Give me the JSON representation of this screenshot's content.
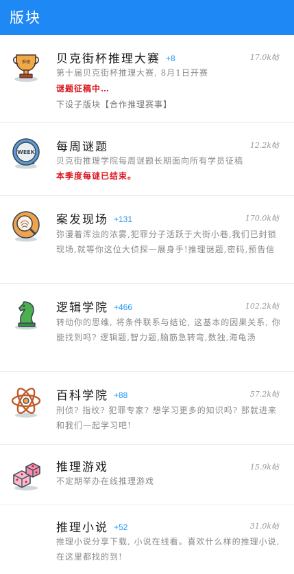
{
  "header": {
    "title": "版块"
  },
  "boards": [
    {
      "icon": "trophy-icon",
      "name": "贝克街杯推理大赛",
      "plus": "+8",
      "posts": "17.0k帖",
      "desc": "第十届贝克街杯推理大赛, 8月1日开赛",
      "note": "谜题征稿中…",
      "sub": "下设子版块【合作推理赛事】"
    },
    {
      "icon": "week-clock-icon",
      "name": "每周谜题",
      "plus": "",
      "posts": "12.2k帖",
      "desc": "贝克街推理学院每周谜题长期面向所有学员征稿",
      "note": "本季度每谜已结束。",
      "sub": ""
    },
    {
      "icon": "magnifier-fingerprint-icon",
      "name": "案发现场",
      "plus": "+131",
      "posts": "170.0k帖",
      "desc": "弥漫着浑浊的浓雾,犯罪分子活跃于大街小巷,我们已封锁现场,就等你这位大侦探一展身手!推理谜题,密码,预告信",
      "note": "",
      "sub": ""
    },
    {
      "icon": "chess-knight-icon",
      "name": "逻辑学院",
      "plus": "+466",
      "posts": "102.2k帖",
      "desc": "转动你的思维, 将条件联系与结论, 这基本的因果关系, 你能找到吗? 逻辑题,智力题,脑筋急转弯,数独,海龟汤",
      "note": "",
      "sub": ""
    },
    {
      "icon": "atom-icon",
      "name": "百科学院",
      "plus": "+88",
      "posts": "57.2k帖",
      "desc": "刑侦? 指纹? 犯罪专家? 想学习更多的知识吗? 那就进来和我们一起学习吧!",
      "note": "",
      "sub": ""
    },
    {
      "icon": "dice-icon",
      "name": "推理游戏",
      "plus": "",
      "posts": "15.9k帖",
      "desc": "不定期举办在线推理游戏",
      "note": "",
      "sub": ""
    },
    {
      "icon": "",
      "name": "推理小说",
      "plus": "+52",
      "posts": "31.0k帖",
      "desc": "推理小说分享下载, 小说在线看。喜欢什么样的推理小说, 在这里都找的到!",
      "note": "",
      "sub": ""
    }
  ],
  "colors": {
    "header": "#1e88f5",
    "accent": "#2196f3",
    "note": "#d9141b"
  }
}
